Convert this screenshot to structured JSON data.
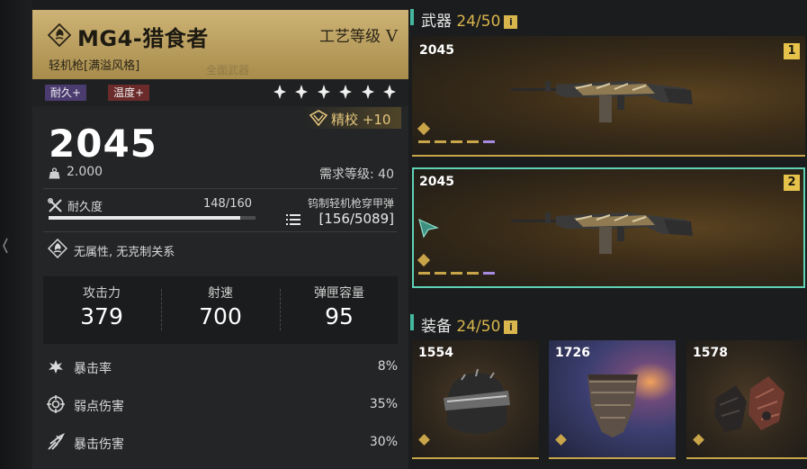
{
  "weapon": {
    "name": "MG4-猎食者",
    "craft_label": "工艺等级",
    "craft_level": "V",
    "type": "轻机枪[满溢风格]",
    "ghost_text": "全面武器",
    "tags": [
      "耐久+",
      "温度+"
    ],
    "star_count": 6,
    "refine": "精校 +10",
    "power": "2045",
    "weight": "2.000",
    "required_level": "需求等级: 40",
    "durability_label": "耐久度",
    "durability_value": "148/160",
    "durability_fraction": 0.925,
    "ammo_name": "钨制轻机枪穿甲弹",
    "ammo_count": "[156/5089]",
    "attribute": "无属性, 无克制关系"
  },
  "stats": [
    {
      "label": "攻击力",
      "value": "379"
    },
    {
      "label": "射速",
      "value": "700"
    },
    {
      "label": "弹匣容量",
      "value": "95"
    }
  ],
  "crit": [
    {
      "label": "暴击率",
      "value": "8%",
      "icon": "burst-icon"
    },
    {
      "label": "弱点伤害",
      "value": "35%",
      "icon": "target-icon"
    },
    {
      "label": "暴击伤害",
      "value": "30%",
      "icon": "crit-damage-icon"
    }
  ],
  "weapons_section": {
    "title": "武器",
    "count": "24/50",
    "info": "i"
  },
  "weapon_slots": [
    {
      "power": "2045",
      "slot": "1",
      "selected": false
    },
    {
      "power": "2045",
      "slot": "2",
      "selected": true
    }
  ],
  "gear_section": {
    "title": "装备",
    "count": "24/50",
    "info": "i"
  },
  "gear": [
    {
      "power": "1554",
      "icon": "helmet-icon"
    },
    {
      "power": "1726",
      "icon": "mask-icon"
    },
    {
      "power": "1578",
      "icon": "gloves-icon"
    }
  ],
  "colors": {
    "gold": "#d9b64d",
    "teal": "#5fd2b5",
    "header": "#cdb375",
    "purple_dash": "#a88ae0"
  }
}
